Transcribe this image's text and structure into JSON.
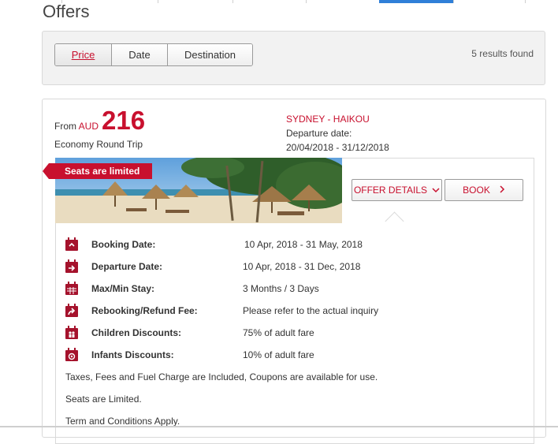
{
  "page": {
    "title": "Offers"
  },
  "sort": {
    "tabs": [
      {
        "label": "Price",
        "active": true
      },
      {
        "label": "Date",
        "active": false
      },
      {
        "label": "Destination",
        "active": false
      }
    ],
    "results_text": "5 results found"
  },
  "offer": {
    "from_prefix": "From",
    "currency": "AUD",
    "price": "216",
    "trip_type": "Economy Round Trip",
    "route": "SYDNEY - HAIKOU",
    "departure_label": "Departure date:",
    "departure_range": "20/04/2018 - 31/12/2018",
    "badge": "Seats are limited",
    "offer_details_label": "OFFER DETAILS",
    "book_label": "BOOK",
    "details": [
      {
        "icon": "calendar-booking-icon",
        "label": "Booking Date:",
        "value": "10 Apr, 2018 - 31 May, 2018"
      },
      {
        "icon": "calendar-departure-icon",
        "label": "Departure Date:",
        "value": "10 Apr, 2018 - 31 Dec, 2018"
      },
      {
        "icon": "calendar-grid-icon",
        "label": "Max/Min Stay:",
        "value": "3 Months / 3 Days"
      },
      {
        "icon": "calendar-rebook-icon",
        "label": "Rebooking/Refund Fee:",
        "value": "Please refer to the actual inquiry"
      },
      {
        "icon": "calendar-children-icon",
        "label": "Children Discounts:",
        "value": "75% of adult fare"
      },
      {
        "icon": "calendar-infant-icon",
        "label": "Infants Discounts:",
        "value": "10% of adult fare"
      }
    ],
    "notes": [
      "Taxes, Fees and Fuel Charge are Included, Coupons are available for use.",
      "Seats are Limited.",
      "Term and Conditions Apply."
    ]
  },
  "colors": {
    "accent": "#c8102e",
    "nav_active": "#2f7fd8"
  }
}
